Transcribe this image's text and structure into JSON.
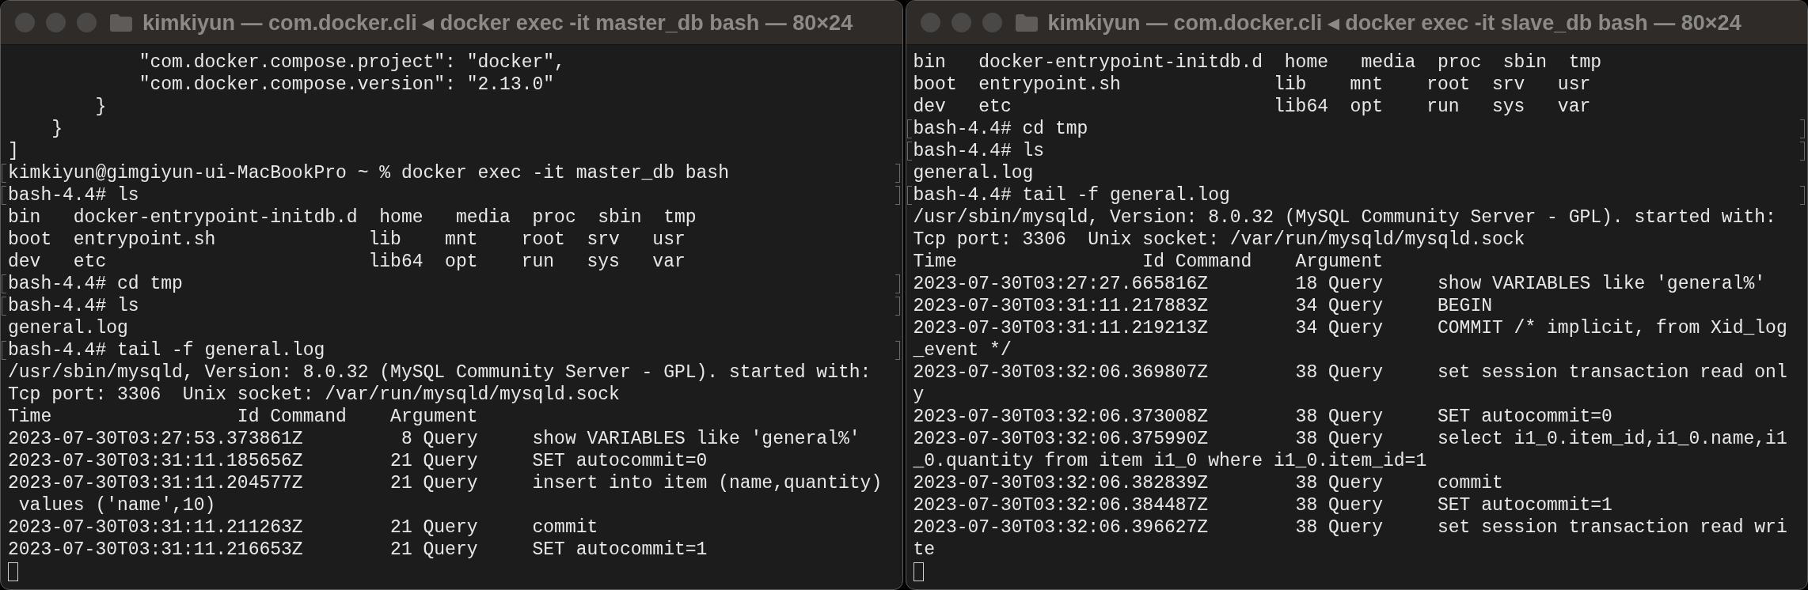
{
  "windows": [
    {
      "title": "kimkiyun — com.docker.cli ◂ docker exec -it master_db bash — 80×24",
      "lines": [
        {
          "text": "            \"com.docker.compose.project\": \"docker\",",
          "prompt_mark": false
        },
        {
          "text": "            \"com.docker.compose.version\": \"2.13.0\"",
          "prompt_mark": false
        },
        {
          "text": "        }",
          "prompt_mark": false
        },
        {
          "text": "    }",
          "prompt_mark": false
        },
        {
          "text": "]",
          "prompt_mark": false
        },
        {
          "text": "kimkiyun@gimgiyun-ui-MacBookPro ~ % docker exec -it master_db bash",
          "prompt_mark": true
        },
        {
          "text": "bash-4.4# ls",
          "prompt_mark": true
        },
        {
          "text": "bin   docker-entrypoint-initdb.d  home   media  proc  sbin  tmp",
          "prompt_mark": false
        },
        {
          "text": "boot  entrypoint.sh              lib    mnt    root  srv   usr",
          "prompt_mark": false
        },
        {
          "text": "dev   etc                        lib64  opt    run   sys   var",
          "prompt_mark": false
        },
        {
          "text": "bash-4.4# cd tmp",
          "prompt_mark": true
        },
        {
          "text": "bash-4.4# ls",
          "prompt_mark": true
        },
        {
          "text": "general.log",
          "prompt_mark": false
        },
        {
          "text": "bash-4.4# tail -f general.log",
          "prompt_mark": true
        },
        {
          "text": "/usr/sbin/mysqld, Version: 8.0.32 (MySQL Community Server - GPL). started with:",
          "prompt_mark": false
        },
        {
          "text": "Tcp port: 3306  Unix socket: /var/run/mysqld/mysqld.sock",
          "prompt_mark": false
        },
        {
          "text": "Time                 Id Command    Argument",
          "prompt_mark": false
        },
        {
          "text": "2023-07-30T03:27:53.373861Z         8 Query     show VARIABLES like 'general%'",
          "prompt_mark": false
        },
        {
          "text": "2023-07-30T03:31:11.185656Z        21 Query     SET autocommit=0",
          "prompt_mark": false
        },
        {
          "text": "2023-07-30T03:31:11.204577Z        21 Query     insert into item (name,quantity)",
          "prompt_mark": false
        },
        {
          "text": " values ('name',10)",
          "prompt_mark": false
        },
        {
          "text": "2023-07-30T03:31:11.211263Z        21 Query     commit",
          "prompt_mark": false
        },
        {
          "text": "2023-07-30T03:31:11.216653Z        21 Query     SET autocommit=1",
          "prompt_mark": false
        }
      ]
    },
    {
      "title": "kimkiyun — com.docker.cli ◂ docker exec -it slave_db bash — 80×24",
      "lines": [
        {
          "text": "bin   docker-entrypoint-initdb.d  home   media  proc  sbin  tmp",
          "prompt_mark": false
        },
        {
          "text": "boot  entrypoint.sh              lib    mnt    root  srv   usr",
          "prompt_mark": false
        },
        {
          "text": "dev   etc                        lib64  opt    run   sys   var",
          "prompt_mark": false
        },
        {
          "text": "bash-4.4# cd tmp",
          "prompt_mark": true
        },
        {
          "text": "bash-4.4# ls",
          "prompt_mark": true
        },
        {
          "text": "general.log",
          "prompt_mark": false
        },
        {
          "text": "bash-4.4# tail -f general.log",
          "prompt_mark": true
        },
        {
          "text": "/usr/sbin/mysqld, Version: 8.0.32 (MySQL Community Server - GPL). started with:",
          "prompt_mark": false
        },
        {
          "text": "Tcp port: 3306  Unix socket: /var/run/mysqld/mysqld.sock",
          "prompt_mark": false
        },
        {
          "text": "Time                 Id Command    Argument",
          "prompt_mark": false
        },
        {
          "text": "2023-07-30T03:27:27.665816Z        18 Query     show VARIABLES like 'general%'",
          "prompt_mark": false
        },
        {
          "text": "2023-07-30T03:31:11.217883Z        34 Query     BEGIN",
          "prompt_mark": false
        },
        {
          "text": "2023-07-30T03:31:11.219213Z        34 Query     COMMIT /* implicit, from Xid_log",
          "prompt_mark": false
        },
        {
          "text": "_event */",
          "prompt_mark": false
        },
        {
          "text": "2023-07-30T03:32:06.369807Z        38 Query     set session transaction read onl",
          "prompt_mark": false
        },
        {
          "text": "y",
          "prompt_mark": false
        },
        {
          "text": "2023-07-30T03:32:06.373008Z        38 Query     SET autocommit=0",
          "prompt_mark": false
        },
        {
          "text": "2023-07-30T03:32:06.375990Z        38 Query     select i1_0.item_id,i1_0.name,i1",
          "prompt_mark": false
        },
        {
          "text": "_0.quantity from item i1_0 where i1_0.item_id=1",
          "prompt_mark": false
        },
        {
          "text": "2023-07-30T03:32:06.382839Z        38 Query     commit",
          "prompt_mark": false
        },
        {
          "text": "2023-07-30T03:32:06.384487Z        38 Query     SET autocommit=1",
          "prompt_mark": false
        },
        {
          "text": "2023-07-30T03:32:06.396627Z        38 Query     set session transaction read wri",
          "prompt_mark": false
        },
        {
          "text": "te",
          "prompt_mark": false
        }
      ]
    }
  ]
}
